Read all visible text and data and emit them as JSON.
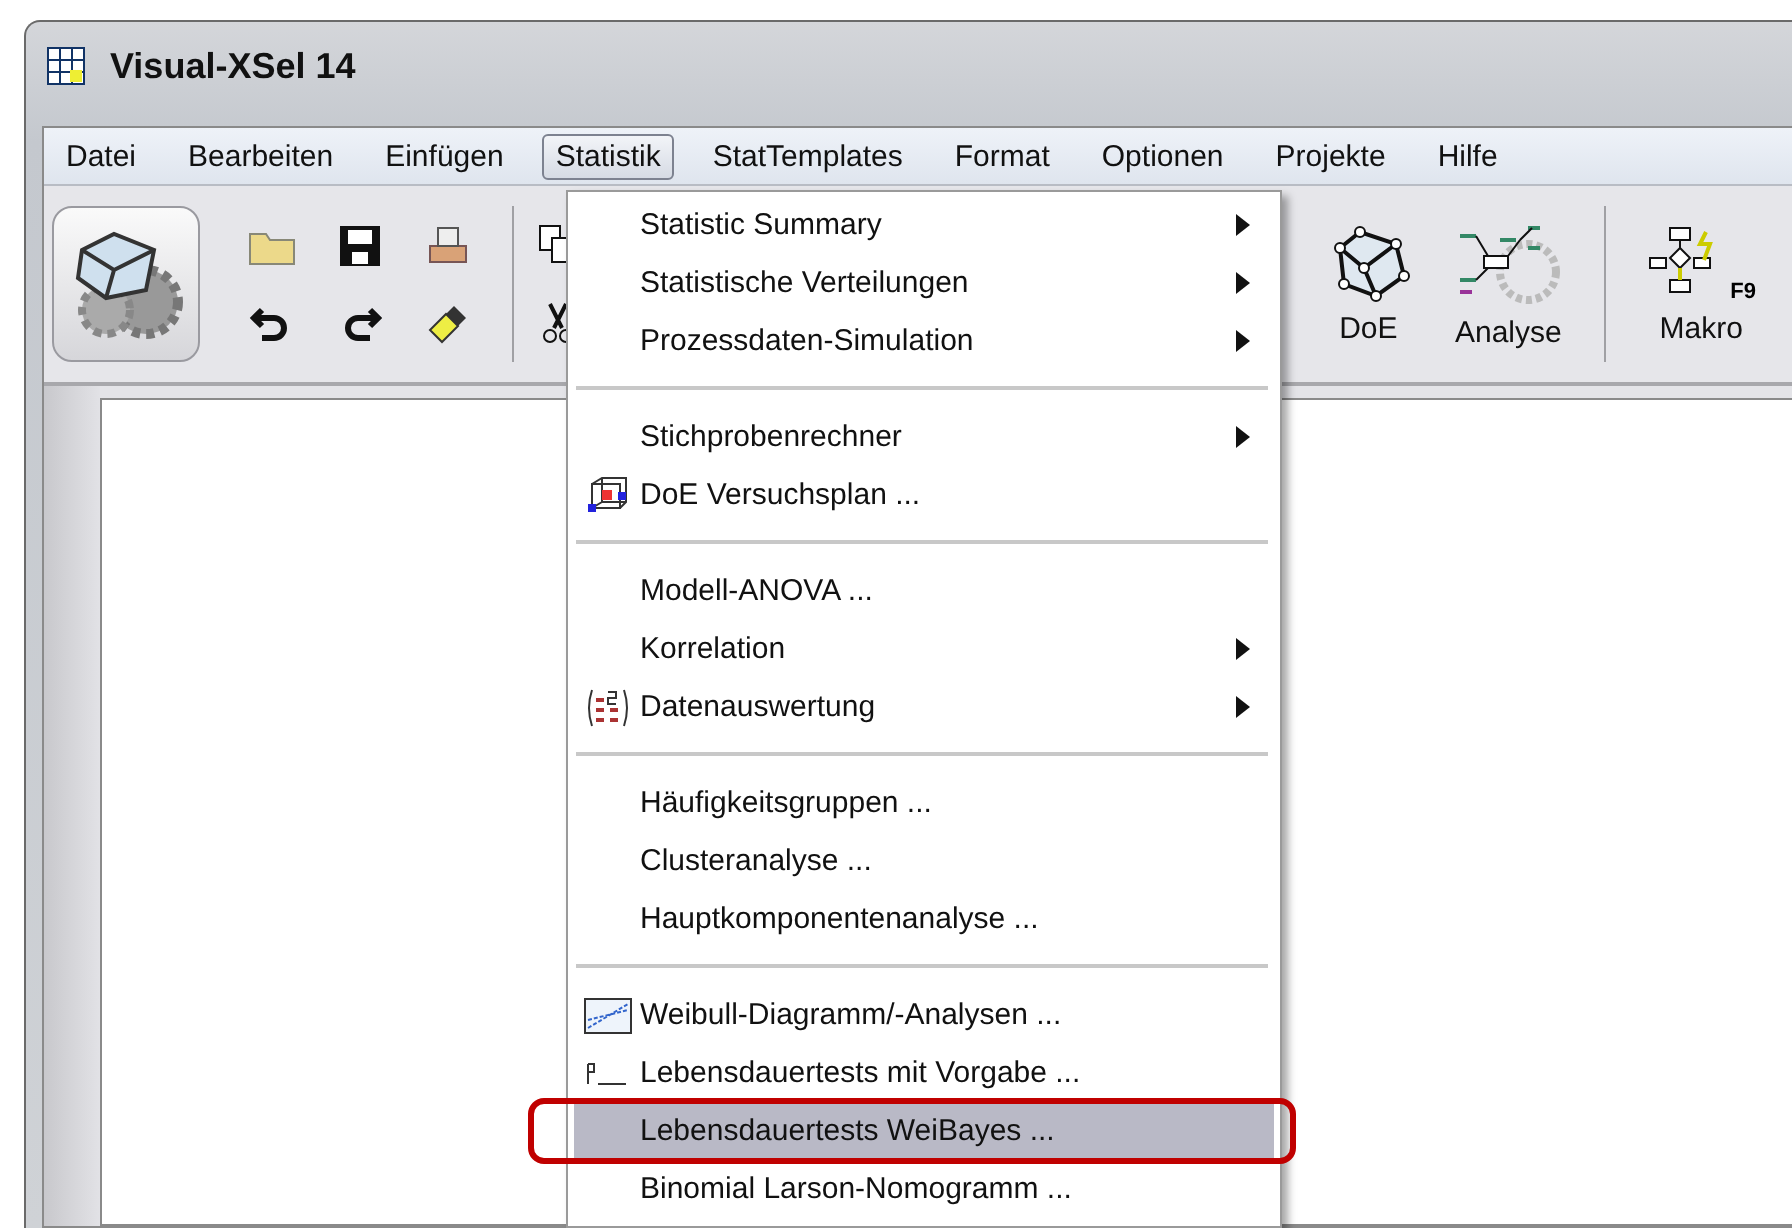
{
  "window": {
    "title": "Visual-XSel 14"
  },
  "menu_bar": [
    {
      "label": "Datei",
      "selected": false
    },
    {
      "label": "Bearbeiten",
      "selected": false
    },
    {
      "label": "Einfügen",
      "selected": false
    },
    {
      "label": "Statistik",
      "selected": true
    },
    {
      "label": "StatTemplates",
      "selected": false
    },
    {
      "label": "Format",
      "selected": false
    },
    {
      "label": "Optionen",
      "selected": false
    },
    {
      "label": "Projekte",
      "selected": false
    },
    {
      "label": "Hilfe",
      "selected": false
    }
  ],
  "toolbar": {
    "buttons": [
      {
        "label": "DoE",
        "kind": "doe"
      },
      {
        "label": "Analyse",
        "kind": "analyse"
      },
      {
        "label": "Makro",
        "kind": "macro",
        "shortcut": "F9"
      }
    ]
  },
  "menu": {
    "sections": [
      [
        {
          "label": "Statistic Summary",
          "kind": "plain",
          "submenu": true,
          "selected": false,
          "annotated": false
        },
        {
          "label": "Statistische Verteilungen",
          "kind": "plain",
          "submenu": true,
          "selected": false,
          "annotated": false
        },
        {
          "label": "Prozessdaten-Simulation",
          "kind": "plain",
          "submenu": true,
          "selected": false,
          "annotated": false
        }
      ],
      [
        {
          "label": "Stichprobenrechner",
          "kind": "plain",
          "submenu": true,
          "selected": false,
          "annotated": false
        },
        {
          "label": "DoE Versuchsplan ...",
          "kind": "doe",
          "submenu": false,
          "selected": false,
          "annotated": false
        }
      ],
      [
        {
          "label": "Modell-ANOVA ...",
          "kind": "plain",
          "submenu": false,
          "selected": false,
          "annotated": false
        },
        {
          "label": "Korrelation",
          "kind": "plain",
          "submenu": true,
          "selected": false,
          "annotated": false
        },
        {
          "label": "Datenauswertung",
          "kind": "regression",
          "submenu": true,
          "selected": false,
          "annotated": false
        }
      ],
      [
        {
          "label": "Häufigkeitsgruppen ...",
          "kind": "plain",
          "submenu": false,
          "selected": false,
          "annotated": false
        },
        {
          "label": "Clusteranalyse ...",
          "kind": "plain",
          "submenu": false,
          "selected": false,
          "annotated": false
        },
        {
          "label": "Hauptkomponentenanalyse ...",
          "kind": "plain",
          "submenu": false,
          "selected": false,
          "annotated": false
        }
      ],
      [
        {
          "label": "Weibull-Diagramm/-Analysen ...",
          "kind": "weibull",
          "submenu": false,
          "selected": false,
          "annotated": false
        },
        {
          "label": "Lebensdauertests mit Vorgabe ...",
          "kind": "life",
          "submenu": false,
          "selected": false,
          "annotated": false
        },
        {
          "label": "Lebensdauertests WeiBayes ...",
          "kind": "plain",
          "submenu": false,
          "selected": true,
          "annotated": true
        },
        {
          "label": "Binomial Larson-Nomogramm ...",
          "kind": "plain",
          "submenu": false,
          "selected": false,
          "annotated": false
        }
      ]
    ]
  }
}
